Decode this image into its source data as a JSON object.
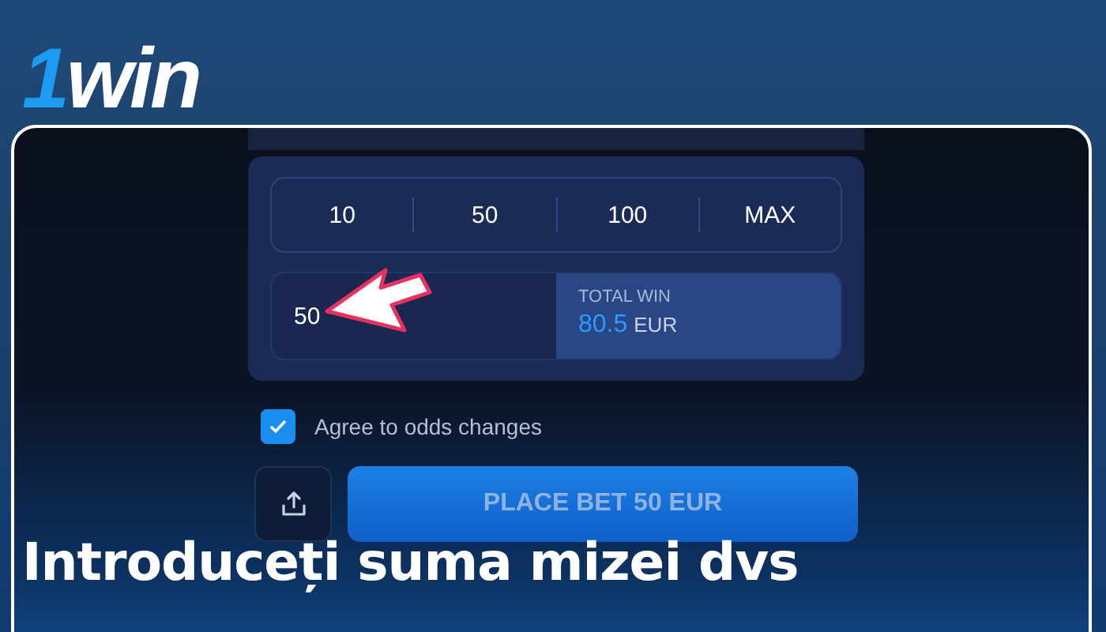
{
  "logo": {
    "number": "1",
    "word": "win"
  },
  "quick_amounts": [
    "10",
    "50",
    "100",
    "MAX"
  ],
  "stake_input": {
    "value": "50"
  },
  "total_win": {
    "label": "TOTAL WIN",
    "amount": "80.5",
    "currency": "EUR"
  },
  "odds_checkbox": {
    "label": "Agree to odds changes",
    "checked": true
  },
  "place_bet_button": "PLACE BET 50 EUR",
  "caption": "Introduceți suma mizei dvs"
}
